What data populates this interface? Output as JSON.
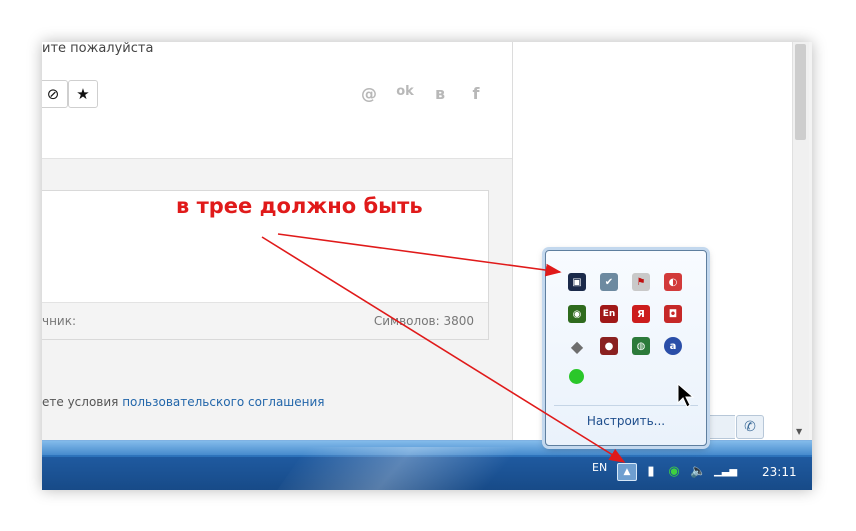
{
  "page": {
    "hint_text": "ите пожалуйста",
    "format_buttons": [
      {
        "label": "⊘",
        "icon": "no-sign-icon"
      },
      {
        "label": "★",
        "icon": "star-icon"
      }
    ],
    "share_icons": [
      {
        "label": "@",
        "icon": "mail-icon"
      },
      {
        "label": "ok",
        "icon": "odnoklassniki-icon"
      },
      {
        "label": "в",
        "icon": "vk-icon"
      },
      {
        "label": "f",
        "icon": "facebook-icon"
      }
    ],
    "editor": {
      "footer_left": "чник:",
      "footer_right": "Символов: 3800"
    },
    "terms": {
      "prefix": "ете условия ",
      "link": "пользовательского соглашения"
    }
  },
  "annotation": {
    "text": "в трее должно быть",
    "color": "#e01a1a"
  },
  "tray_popup": {
    "icons": [
      {
        "name": "display-icon",
        "bg": "#1b2a4a",
        "glyph": "▣"
      },
      {
        "name": "usb-safe-remove-icon",
        "bg": "#6d8aa0",
        "glyph": "✔"
      },
      {
        "name": "action-center-flag-icon",
        "bg": "#c9c9c9",
        "glyph": "⚑"
      },
      {
        "name": "security-shield-icon",
        "bg": "#d23a3a",
        "glyph": "◐"
      },
      {
        "name": "nvidia-icon",
        "bg": "#2f6b1e",
        "glyph": "◉"
      },
      {
        "name": "lingvo-en-icon",
        "bg": "#a01818",
        "glyph": "En"
      },
      {
        "name": "avira-icon",
        "bg": "#cc1d1d",
        "glyph": "Я"
      },
      {
        "name": "camera-icon",
        "bg": "#c62828",
        "glyph": "◘"
      },
      {
        "name": "diamond-icon",
        "bg": "#7a7a7a",
        "glyph": "◆"
      },
      {
        "name": "record-icon",
        "bg": "#8a2020",
        "glyph": "●"
      },
      {
        "name": "network-globe-icon",
        "bg": "#2c7a3a",
        "glyph": "◍"
      },
      {
        "name": "a-circle-icon",
        "bg": "#2a4ea8",
        "glyph": "a"
      },
      {
        "name": "green-dot-icon",
        "bg": "#2ac72a",
        "glyph": ""
      }
    ],
    "customize_label": "Настроить..."
  },
  "taskbar": {
    "language": "EN",
    "tray_toggle_icon": "chevron-up-icon",
    "icons": [
      "usb-device-icon",
      "green-circle-icon",
      "speaker-icon",
      "signal-bars-icon"
    ],
    "clock": "23:11"
  }
}
